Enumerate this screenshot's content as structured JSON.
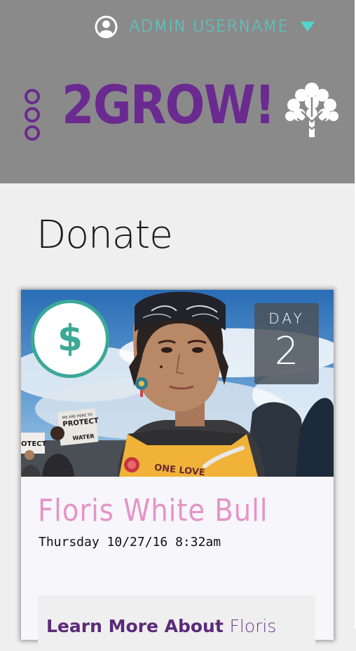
{
  "header": {
    "username": "ADMIN USERNAME",
    "logo_text": "2GROW!"
  },
  "page": {
    "title": "Donate"
  },
  "card": {
    "badge_symbol": "$",
    "day_label": "DAY",
    "day_number": "2",
    "name": "Floris White Bull",
    "date": "Thursday 10/27/16 8:32am",
    "learn_more_bold": "Learn More About ",
    "learn_more_name": "Floris",
    "photo_sign_text": "PROTECT",
    "photo_sign_text_2": "WATER",
    "photo_sign_text_3": "OTECT",
    "photo_sign_text_4": "WE ARE HERE TO",
    "photo_vest_text": "ONE LOVE"
  },
  "colors": {
    "header_bg": "#8a8a8b",
    "accent_teal": "#4fd7cf",
    "brand_purple": "#6a2a90",
    "badge_green": "#3ba997",
    "name_pink": "#e494c8"
  },
  "icons": {
    "user": "user-circle-icon",
    "caret": "caret-down-icon",
    "menu": "vertical-dots-menu-icon",
    "tree": "tree-icon"
  }
}
